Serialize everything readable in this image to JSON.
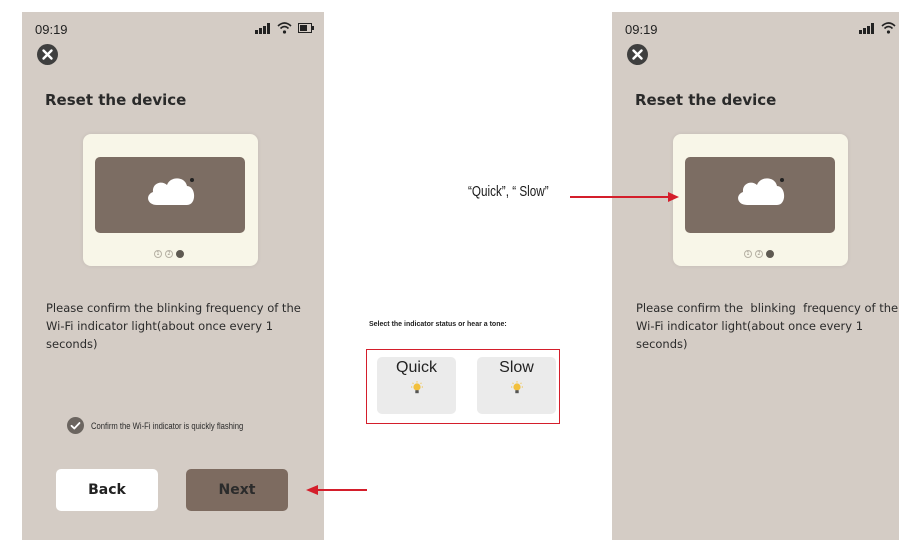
{
  "left_phone": {
    "time": "09:19",
    "title": "Reset the device",
    "instruction": "Please confirm the blinking frequency of the Wi-Fi indicator light(about once every 1 seconds)",
    "page_dots": [
      "1",
      "2",
      "3"
    ],
    "confirm_text": "Confirm the Wi-Fi indicator is quickly flashing",
    "back_label": "Back",
    "next_label": "Next"
  },
  "right_phone": {
    "time": "09:19",
    "title": "Reset the device",
    "instruction": "Please confirm the  blinking  frequency of the Wi-Fi indicator light(about once every 1 seconds)",
    "page_dots": [
      "1",
      "2",
      "3"
    ]
  },
  "annotation": {
    "quick_slow_label": "“Quick”, “ Slow”"
  },
  "selector": {
    "caption": "Select the indicator status or hear a tone:",
    "quick_label": "Quick",
    "slow_label": "Slow"
  },
  "colors": {
    "phone_background": "#d4ccc5",
    "next_button": "#7d6b60",
    "annotation_red": "#d41e2b"
  }
}
